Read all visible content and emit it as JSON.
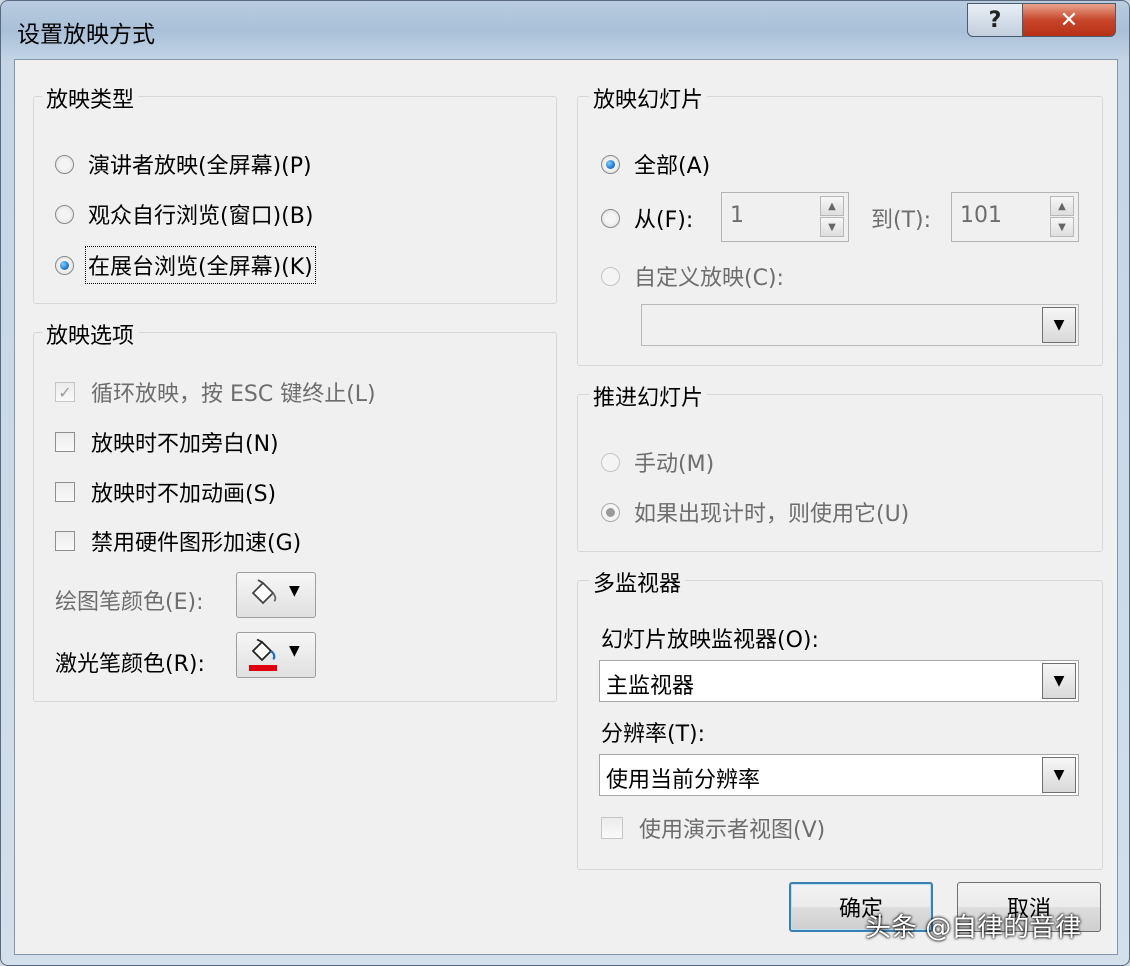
{
  "window": {
    "title": "设置放映方式",
    "help_label": "?",
    "close_label": "✕"
  },
  "show_type": {
    "title": "放映类型",
    "options": [
      {
        "label": "演讲者放映(全屏幕)(P)",
        "checked": false
      },
      {
        "label": "观众自行浏览(窗口)(B)",
        "checked": false
      },
      {
        "label": "在展台浏览(全屏幕)(K)",
        "checked": true
      }
    ]
  },
  "show_options": {
    "title": "放映选项",
    "checkboxes": [
      {
        "label": "循环放映，按 ESC 键终止(L)",
        "checked": true,
        "disabled": true
      },
      {
        "label": "放映时不加旁白(N)",
        "checked": false,
        "disabled": false
      },
      {
        "label": "放映时不加动画(S)",
        "checked": false,
        "disabled": false
      },
      {
        "label": "禁用硬件图形加速(G)",
        "checked": false,
        "disabled": false
      }
    ],
    "pen_color_label": "绘图笔颜色(E):",
    "laser_color_label": "激光笔颜色(R):",
    "laser_color": "#e0000f"
  },
  "show_slides": {
    "title": "放映幻灯片",
    "all_label": "全部(A)",
    "from_label": "从(F):",
    "from_value": "1",
    "to_label": "到(T):",
    "to_value": "101",
    "custom_label": "自定义放映(C):",
    "custom_value": ""
  },
  "advance": {
    "title": "推进幻灯片",
    "manual_label": "手动(M)",
    "timing_label": "如果出现计时，则使用它(U)"
  },
  "monitors": {
    "title": "多监视器",
    "monitor_label": "幻灯片放映监视器(O):",
    "monitor_value": "主监视器",
    "resolution_label": "分辨率(T):",
    "resolution_value": "使用当前分辨率",
    "presenter_view_label": "使用演示者视图(V)"
  },
  "buttons": {
    "ok": "确定",
    "cancel": "取消"
  },
  "watermark": "头条 @自律的音律"
}
